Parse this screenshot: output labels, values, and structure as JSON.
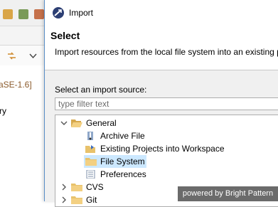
{
  "background": {
    "jre_label": "aSE-1.6]",
    "partial_text": "ry"
  },
  "dialog": {
    "title": "Import",
    "banner": {
      "heading": "Select",
      "description": "Import resources from the local file system into an existing p"
    },
    "source_label": "Select an import source:",
    "filter_placeholder": "type filter text",
    "tree": [
      {
        "label": "General",
        "expanded": true,
        "level": 0,
        "icon": "folder-open-icon"
      },
      {
        "label": "Archive File",
        "level": 1,
        "icon": "archive-file-icon"
      },
      {
        "label": "Existing Projects into Workspace",
        "level": 1,
        "icon": "existing-projects-icon"
      },
      {
        "label": "File System",
        "level": 1,
        "icon": "folder-icon",
        "selected": true
      },
      {
        "label": "Preferences",
        "level": 1,
        "icon": "preferences-icon"
      },
      {
        "label": "CVS",
        "expanded": false,
        "level": 0,
        "icon": "folder-icon"
      },
      {
        "label": "Git",
        "expanded": false,
        "level": 0,
        "icon": "folder-icon"
      }
    ]
  },
  "watermark": "powered by Bright Pattern",
  "colors": {
    "selection": "#cce8ff",
    "folder": "#e8c26b",
    "jre_text": "#8b5a2b"
  }
}
